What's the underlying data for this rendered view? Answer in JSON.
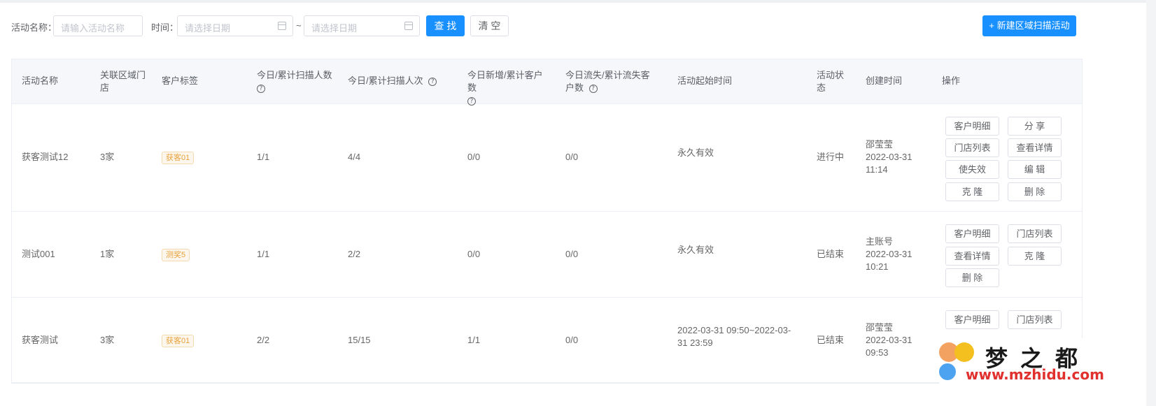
{
  "filters": {
    "name_label": "活动名称：",
    "name_placeholder": "请输入活动名称",
    "time_label": "时间：",
    "start_placeholder": "请选择日期",
    "range_sep": "~",
    "end_placeholder": "请选择日期",
    "search_label": "查 找",
    "clear_label": "清 空",
    "create_label": "+ 新建区域扫描活动"
  },
  "columns": {
    "name": "活动名称",
    "stores": "关联区域门店",
    "tags": "客户标签",
    "scan_people": "今日/累计扫描人数",
    "scan_times": "今日/累计扫描人次",
    "new_customers": "今日新增/累计客户数",
    "lost_customers": "今日流失/累计流失客户数",
    "period": "活动起始时间",
    "status": "活动状态",
    "created": "创建时间",
    "ops": "操作"
  },
  "rows": [
    {
      "name": "获客测试12",
      "stores": "3家",
      "tag": "获客01",
      "scan_people": "1/1",
      "scan_times": "4/4",
      "new_customers": "0/0",
      "lost_customers": "0/0",
      "period": "永久有效",
      "status": "进行中",
      "creator": "邵莹莹",
      "created_date": "2022-03-31",
      "created_time": "11:14",
      "ops": [
        "客户明细",
        "分 享",
        "门店列表",
        "查看详情",
        "使失效",
        "编 辑",
        "克 隆",
        "删 除"
      ]
    },
    {
      "name": "测试001",
      "stores": "1家",
      "tag": "测奖5",
      "scan_people": "1/1",
      "scan_times": "2/2",
      "new_customers": "0/0",
      "lost_customers": "0/0",
      "period": "永久有效",
      "status": "已结束",
      "creator": "主账号",
      "created_date": "2022-03-31",
      "created_time": "10:21",
      "ops": [
        "客户明细",
        "门店列表",
        "查看详情",
        "克 隆",
        "删 除"
      ]
    },
    {
      "name": "获客测试",
      "stores": "3家",
      "tag": "获客01",
      "scan_people": "2/2",
      "scan_times": "15/15",
      "new_customers": "1/1",
      "lost_customers": "0/0",
      "period": "2022-03-31 09:50~2022-03-31 23:59",
      "status": "已结束",
      "creator": "邵莹莹",
      "created_date": "2022-03-31",
      "created_time": "09:53",
      "ops": [
        "客户明细",
        "门店列表"
      ]
    }
  ],
  "watermark": {
    "brand": "梦之都",
    "url": "www.mzhidu.com"
  },
  "colors": {
    "primary": "#1890ff",
    "tag_text": "#e6a23c",
    "header_bg": "#f5f7fa"
  }
}
